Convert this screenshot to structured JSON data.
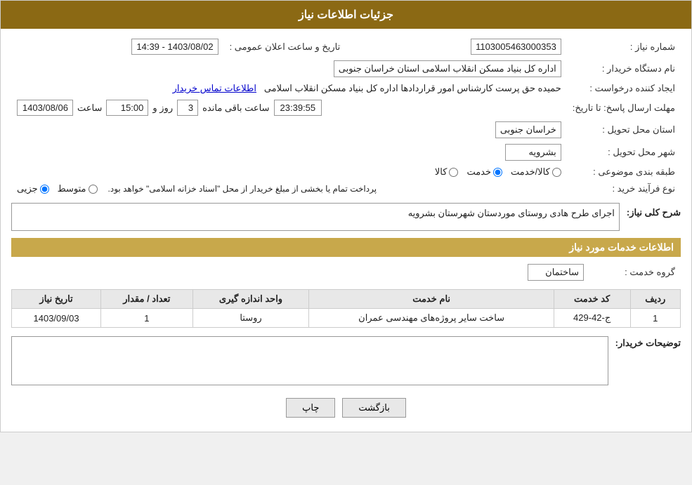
{
  "header": {
    "title": "جزئیات اطلاعات نیاز"
  },
  "fields": {
    "need_number_label": "شماره نیاز :",
    "need_number_value": "1103005463000353",
    "buyer_org_label": "نام دستگاه خریدار :",
    "buyer_org_value": "اداره کل بنیاد مسکن انقلاب اسلامی استان خراسان جنوبی",
    "creator_label": "ایجاد کننده درخواست :",
    "creator_value": "حمیده حق پرست کارشناس امور قراردادها اداره کل بنیاد مسکن انقلاب اسلامی",
    "creator_link": "اطلاعات تماس خریدار",
    "date_label": "تاریخ و ساعت اعلان عمومی :",
    "date_value": "1403/08/02 - 14:39",
    "deadline_label": "مهلت ارسال پاسخ: تا تاریخ:",
    "deadline_date": "1403/08/06",
    "deadline_time_label": "ساعت",
    "deadline_time": "15:00",
    "deadline_day_label": "روز و",
    "deadline_days": "3",
    "deadline_remaining_label": "ساعت باقی مانده",
    "deadline_remaining": "23:39:55",
    "province_label": "استان محل تحویل :",
    "province_value": "خراسان جنوبی",
    "city_label": "شهر محل تحویل :",
    "city_value": "بشرویه",
    "category_label": "طبقه بندی موضوعی :",
    "category_options": [
      "کالا",
      "خدمت",
      "کالا/خدمت"
    ],
    "category_selected": "خدمت",
    "purchase_type_label": "نوع فرآیند خرید :",
    "purchase_options": [
      "جزیی",
      "متوسط"
    ],
    "purchase_note": "پرداخت تمام یا بخشی از مبلغ خریدار از محل \"اسناد خزانه اسلامی\" خواهد بود.",
    "general_desc_label": "شرح کلی نیاز:",
    "general_desc_value": "اجرای طرح هادی روستای موردستان شهرستان بشرویه",
    "services_info_label": "اطلاعات خدمات مورد نیاز",
    "service_group_label": "گروه خدمت :",
    "service_group_value": "ساختمان",
    "table_headers": {
      "row_num": "ردیف",
      "service_code": "کد خدمت",
      "service_name": "نام خدمت",
      "measurement_unit": "واحد اندازه گیری",
      "quantity": "تعداد / مقدار",
      "date": "تاریخ نیاز"
    },
    "table_rows": [
      {
        "row_num": "1",
        "service_code": "ج-42-429",
        "service_name": "ساخت سایر پروژه‌های مهندسی عمران",
        "measurement_unit": "روستا",
        "quantity": "1",
        "date": "1403/09/03"
      }
    ],
    "buyer_desc_label": "توضیحات خریدار:",
    "buyer_desc_value": ""
  },
  "buttons": {
    "print": "چاپ",
    "back": "بازگشت"
  }
}
